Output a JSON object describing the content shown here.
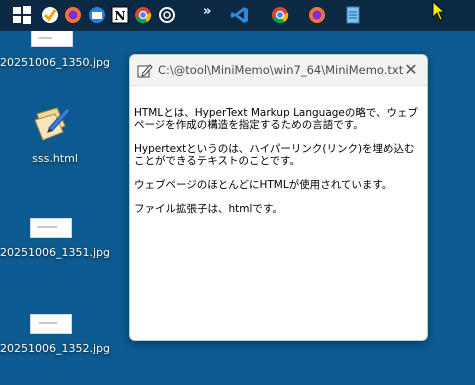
{
  "taskbar": {
    "icons": [
      "windows-start-icon",
      "task-checker-icon",
      "firefox-icon",
      "thunderbird-icon",
      "notion-icon",
      "chrome-icon",
      "chatgpt-icon",
      "vscode-icon",
      "chrome-icon",
      "firefox-icon",
      "notepad-icon"
    ],
    "overflow_label": "»"
  },
  "desktop": {
    "items": [
      {
        "label": "20251006_1350.jpg"
      },
      {
        "label": "sss.html"
      },
      {
        "label": "20251006_1351.jpg"
      },
      {
        "label": "20251006_1352.jpg"
      }
    ]
  },
  "window": {
    "title": "C:\\@tool\\MiniMemo\\win7_64\\MiniMemo.txt",
    "close_label": "✕",
    "paragraphs": [
      "HTMLとは、HyperText Markup Languageの略で、ウェブページを作成の構造を指定するための言語です。",
      "Hypertextというのは、ハイパーリンク(リンク)を埋め込むことができるテキストのことです。",
      "ウェブページのほとんどにHTMLが使用されています。",
      "ファイル拡張子は、htmlです。"
    ]
  }
}
